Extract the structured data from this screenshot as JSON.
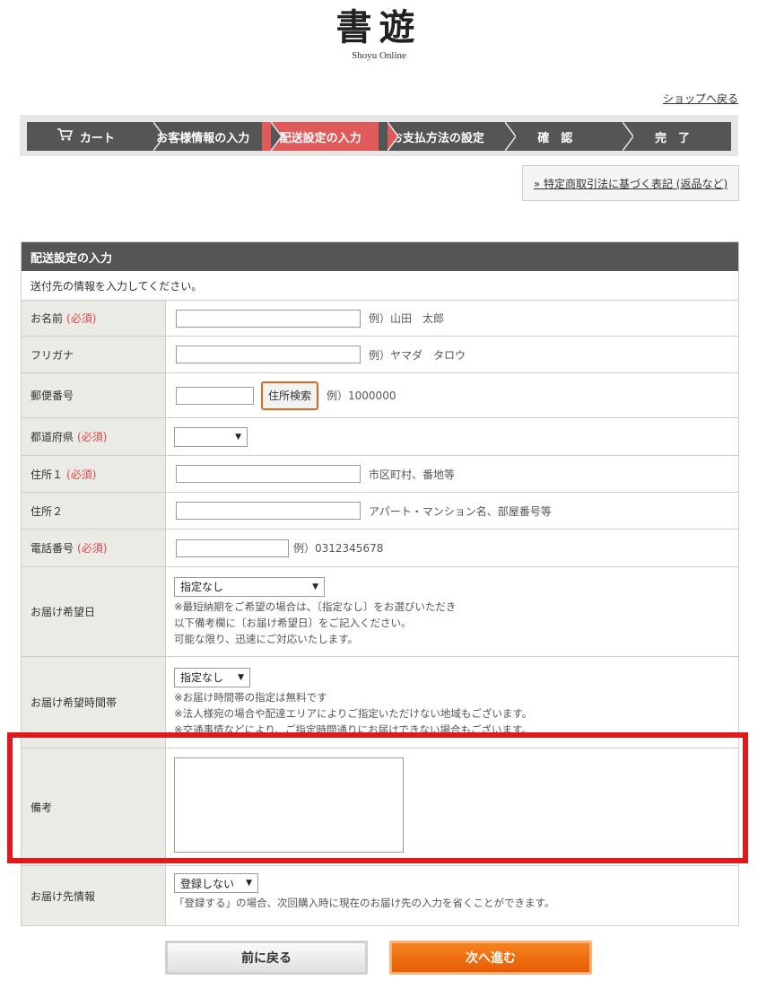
{
  "logo": {
    "mark": "書遊",
    "subtitle": "Shoyu Online"
  },
  "header": {
    "back_to_shop": "ショップへ戻る"
  },
  "steps": [
    {
      "label": "カート",
      "icon": "cart-icon"
    },
    {
      "label": "お客様情報の入力"
    },
    {
      "label": "配送設定の入力",
      "active": true
    },
    {
      "label": "お支払方法の設定"
    },
    {
      "label": "確　認"
    },
    {
      "label": "完　了"
    }
  ],
  "law_link": "» 特定商取引法に基づく表記 (返品など)",
  "form": {
    "title": "配送設定の入力",
    "intro": "送付先の情報を入力してください。",
    "required_mark": "(必須)",
    "name": {
      "label": "お名前",
      "hint": "例）山田　太郎"
    },
    "furigana": {
      "label": "フリガナ",
      "hint": "例）ヤマダ　タロウ"
    },
    "postal": {
      "label": "郵便番号",
      "button": "住所検索",
      "hint": "例）1000000"
    },
    "prefecture": {
      "label": "都道府県",
      "selected": ""
    },
    "address1": {
      "label": "住所１",
      "hint": "市区町村、番地等"
    },
    "address2": {
      "label": "住所２",
      "hint": "アパート・マンション名、部屋番号等"
    },
    "phone": {
      "label": "電話番号",
      "hint": "例）0312345678"
    },
    "delivery_date": {
      "label": "お届け希望日",
      "selected": "指定なし",
      "notes": [
        "※最短納期をご希望の場合は、〔指定なし〕をお選びいただき",
        "以下備考欄に〔お届け希望日〕をご記入ください。",
        "可能な限り、迅速にご対応いたします。"
      ]
    },
    "delivery_time": {
      "label": "お届け希望時間帯",
      "selected": "指定なし",
      "notes": [
        "※お届け時間帯の指定は無料です",
        "※法人様宛の場合や配達エリアによりご指定いただけない地域もございます。",
        "※交通事情などにより、ご指定時間通りにお届けできない場合もございます。"
      ]
    },
    "remarks": {
      "label": "備考",
      "value": ""
    },
    "register": {
      "label": "お届け先情報",
      "selected": "登録しない",
      "note": "「登録する」の場合、次回購入時に現在のお届け先の入力を省くことができます。"
    }
  },
  "buttons": {
    "prev": "前に戻る",
    "next": "次へ進む"
  },
  "colors": {
    "accent": "#e05a5a",
    "required": "#e0464b",
    "next_button": "#f06f10",
    "highlight": "#e0191c"
  }
}
